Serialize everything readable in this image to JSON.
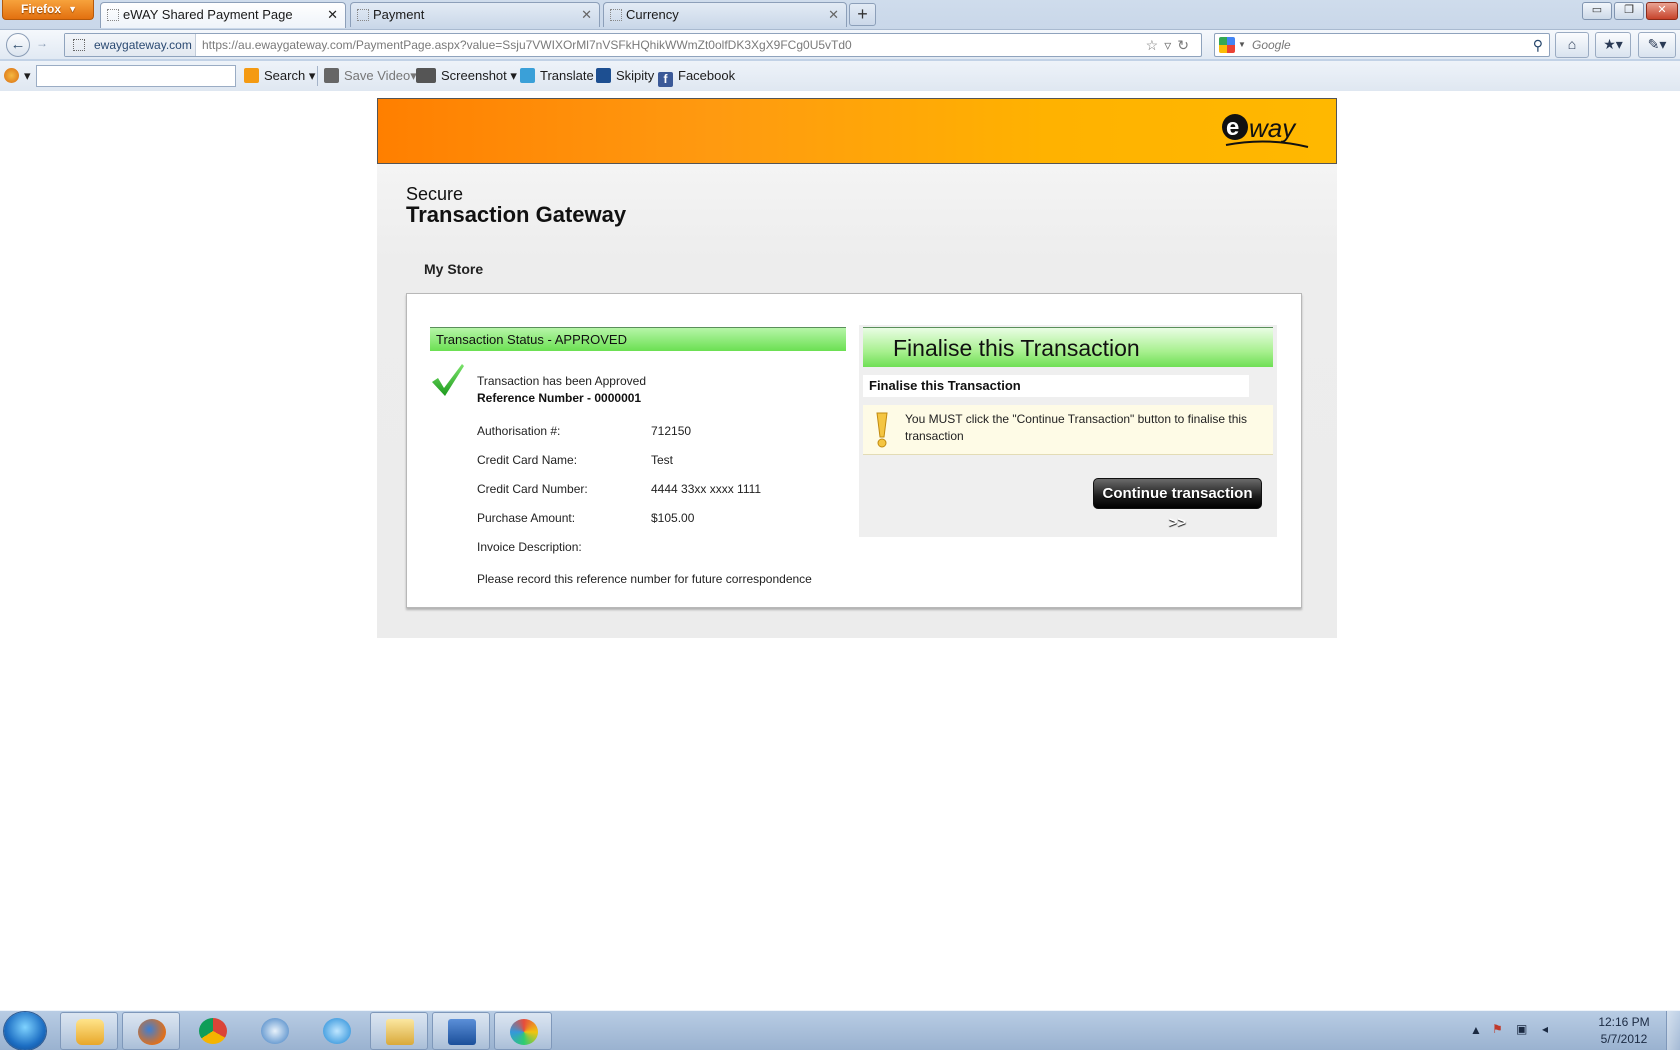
{
  "browser": {
    "app_button": "Firefox",
    "tabs": [
      {
        "title": "eWAY Shared Payment Page"
      },
      {
        "title": "Payment"
      },
      {
        "title": "Currency"
      }
    ],
    "new_tab": "+",
    "site_identity": "ewaygateway.com",
    "url": "https://au.ewaygateway.com/PaymentPage.aspx?value=Ssju7VWIXOrMl7nVSFkHQhikWWmZt0olfDK3XgX9FCg0U5vTd0",
    "search_placeholder": "Google",
    "toolbar": {
      "search_label": "Search",
      "save_video_label": "Save Video",
      "screenshot_label": "Screenshot",
      "translate_label": "Translate",
      "skipity_label": "Skipity",
      "facebook_label": "Facebook"
    }
  },
  "page": {
    "heading_small": "Secure",
    "heading_big": "Transaction Gateway",
    "store_name": "My Store",
    "status_title": "Transaction Status - APPROVED",
    "approved_message": "Transaction has been Approved",
    "reference": "Reference Number - 0000001",
    "details": [
      {
        "label": "Authorisation #:",
        "value": "712150"
      },
      {
        "label": "Credit Card Name:",
        "value": "Test"
      },
      {
        "label": "Credit Card Number:",
        "value": "4444 33xx xxxx 1111"
      },
      {
        "label": "Purchase Amount:",
        "value": "$105.00"
      },
      {
        "label": "Invoice Description:",
        "value": ""
      }
    ],
    "note": "Please record this reference number for future correspondence",
    "finalise_header": "Finalise this Transaction",
    "finalise_sub": "Finalise this Transaction",
    "warning": "You MUST click the \"Continue Transaction\" button to finalise this transaction",
    "continue_button": "Continue transaction >>"
  },
  "taskbar": {
    "time": "12:16 PM",
    "date": "5/7/2012"
  },
  "colors": {
    "banner_start": "#ff7f00",
    "banner_end": "#ffb800",
    "status_green": "#6be052",
    "warning_bg": "#fefbe6"
  }
}
